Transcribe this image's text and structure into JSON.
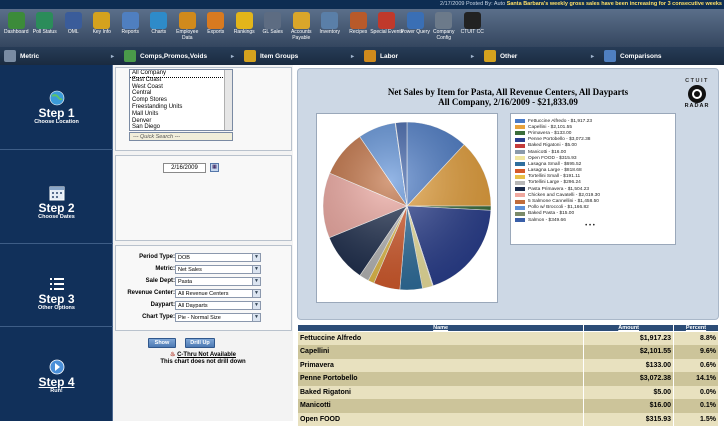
{
  "ticker": {
    "date_posted": "2/17/2009 Posted By: Auto",
    "message": "Santa Barbara's weekly gross sales have been increasing for 3 consecutive weeks"
  },
  "toolbar": [
    {
      "label": "Dashboard",
      "icon": "dashboard-icon",
      "color": "#3c8b3a"
    },
    {
      "label": "Poll Status",
      "icon": "poll-status-icon",
      "color": "#2b8c5a"
    },
    {
      "label": "OML",
      "icon": "oml-icon",
      "color": "#3a5c9a"
    },
    {
      "label": "Key Info",
      "icon": "key-icon",
      "color": "#d4a21e"
    },
    {
      "label": "Reports",
      "icon": "reports-icon",
      "color": "#4f7fc0"
    },
    {
      "label": "Charts",
      "icon": "charts-icon",
      "color": "#2e8bc9"
    },
    {
      "label": "Employee Data",
      "icon": "employee-icon",
      "color": "#d08a1c"
    },
    {
      "label": "Exports",
      "icon": "exports-icon",
      "color": "#d87a20"
    },
    {
      "label": "Rankings",
      "icon": "rankings-star-icon",
      "color": "#e2b51a"
    },
    {
      "label": "GL Sales",
      "icon": "gl-sales-icon",
      "color": "#5d6c82"
    },
    {
      "label": "Accounts Payable",
      "icon": "accounts-payable-icon",
      "color": "#d9a62a"
    },
    {
      "label": "Inventory",
      "icon": "inventory-icon",
      "color": "#5a7fa8"
    },
    {
      "label": "Recipes",
      "icon": "recipes-icon",
      "color": "#b85a2a"
    },
    {
      "label": "Special Events",
      "icon": "special-events-icon",
      "color": "#c0392b"
    },
    {
      "label": "Power Query",
      "icon": "power-query-icon",
      "color": "#3a6fb5"
    },
    {
      "label": "Company Config",
      "icon": "company-config-icon",
      "color": "#6c7a8a"
    },
    {
      "label": "CTUIT CC",
      "icon": "ctuit-radar-icon",
      "color": "#222222"
    }
  ],
  "navbar": [
    {
      "label": "Metric",
      "icon": "metric-icon",
      "color": "#7a8ca3"
    },
    {
      "label": "Comps,Promos,Voids",
      "icon": "comps-icon",
      "color": "#4a9a4a"
    },
    {
      "label": "Item Groups",
      "icon": "item-groups-icon",
      "color": "#d4a21e"
    },
    {
      "label": "Labor",
      "icon": "labor-icon",
      "color": "#d08a1c"
    },
    {
      "label": "Other",
      "icon": "other-icon",
      "color": "#d4a21e"
    },
    {
      "label": "Comparisons",
      "icon": "comparisons-icon",
      "color": "#4f7fc0"
    }
  ],
  "steps": [
    {
      "title": "Step 1",
      "subtitle": "Choose Location"
    },
    {
      "title": "Step 2",
      "subtitle": "Choose Dates"
    },
    {
      "title": "Step 3",
      "subtitle": "Other Options"
    },
    {
      "title": "Step 4",
      "subtitle": "Run!"
    }
  ],
  "locations": [
    "All Company",
    "East Coast",
    "West Coast",
    "Central",
    "Comp Stores",
    "Freestanding Units",
    "Mall Units",
    "Denver",
    "San Diego"
  ],
  "quick_search": "--- Quick Search ---",
  "date": "2/16/2009",
  "options": [
    {
      "label": "Period Type:",
      "value": "DOB"
    },
    {
      "label": "Metric:",
      "value": "Net Sales"
    },
    {
      "label": "Sale Dept:",
      "value": "Pasta"
    },
    {
      "label": "Revenue Center:",
      "value": "All Revenue Centers"
    },
    {
      "label": "Daypart:",
      "value": "All Dayparts"
    },
    {
      "label": "Chart Type:",
      "value": "Pie - Normal Size"
    }
  ],
  "buttons": {
    "show": "Show",
    "drill": "Drill Up"
  },
  "drill": {
    "link": "C-Thru Not Available",
    "note": "This chart does not drill down"
  },
  "chart_title_1": "Net Sales by Item for Pasta, All Revenue Centers, All Dayparts",
  "chart_title_2": "All Company, 2/16/2009 - $21,833.09",
  "radar": {
    "top": "CTUIT",
    "bottom": "RADAR"
  },
  "chart_data": {
    "type": "pie",
    "slices": [
      {
        "label": "Fettuccine Alfredo - $1,917.23",
        "value": 1917.23,
        "color": "#4a7bc8"
      },
      {
        "label": "Capellini - $2,101.55",
        "value": 2101.55,
        "color": "#e8a23c"
      },
      {
        "label": "Primavera - $133.00",
        "value": 133.0,
        "color": "#3b6e3b"
      },
      {
        "label": "Penne Portobello - $3,072.38",
        "value": 3072.38,
        "color": "#2a3f8f"
      },
      {
        "label": "Baked Rigatoni - $5.00",
        "value": 5.0,
        "color": "#c43c3c"
      },
      {
        "label": "Manicotti - $16.00",
        "value": 16.0,
        "color": "#8a9aaa"
      },
      {
        "label": "Open FOOD - $315.93",
        "value": 315.93,
        "color": "#f0e6a0"
      },
      {
        "label": "Lasagna Small - $695.52",
        "value": 695.52,
        "color": "#2e6f9e"
      },
      {
        "label": "Lasagna Large - $818.68",
        "value": 818.68,
        "color": "#d65a2a"
      },
      {
        "label": "Tortellini Small - $191.11",
        "value": 191.11,
        "color": "#e8c048"
      },
      {
        "label": "Tortellini Large - $296.24",
        "value": 296.24,
        "color": "#b8b8b8"
      },
      {
        "label": "Pasta Primavera - $1,504.23",
        "value": 1504.23,
        "color": "#1a2a4a"
      },
      {
        "label": "Chicken and Cavatelli - $2,019.30",
        "value": 2019.3,
        "color": "#f0a8a0"
      },
      {
        "label": "5 Salmone Cannellini - $1,458.50",
        "value": 1458.5,
        "color": "#c06c3c"
      },
      {
        "label": "Pollo w/ Broccoli - $1,166.82",
        "value": 1166.82,
        "color": "#5b8fd8"
      },
      {
        "label": "Baked Pasta - $15.00",
        "value": 15.0,
        "color": "#7b8b6b"
      },
      {
        "label": "Salmon - $349.66",
        "value": 349.66,
        "color": "#3a5fa8"
      }
    ],
    "more": "• • •"
  },
  "table": {
    "headers": [
      "Name",
      "Amount",
      "Percent"
    ],
    "rows": [
      [
        "Fettuccine Alfredo",
        "$1,917.23",
        "8.8%"
      ],
      [
        "Capellini",
        "$2,101.55",
        "9.6%"
      ],
      [
        "Primavera",
        "$133.00",
        "0.6%"
      ],
      [
        "Penne Portobello",
        "$3,072.38",
        "14.1%"
      ],
      [
        "Baked Rigatoni",
        "$5.00",
        "0.0%"
      ],
      [
        "Manicotti",
        "$16.00",
        "0.1%"
      ],
      [
        "Open FOOD",
        "$315.93",
        "1.5%"
      ]
    ]
  }
}
